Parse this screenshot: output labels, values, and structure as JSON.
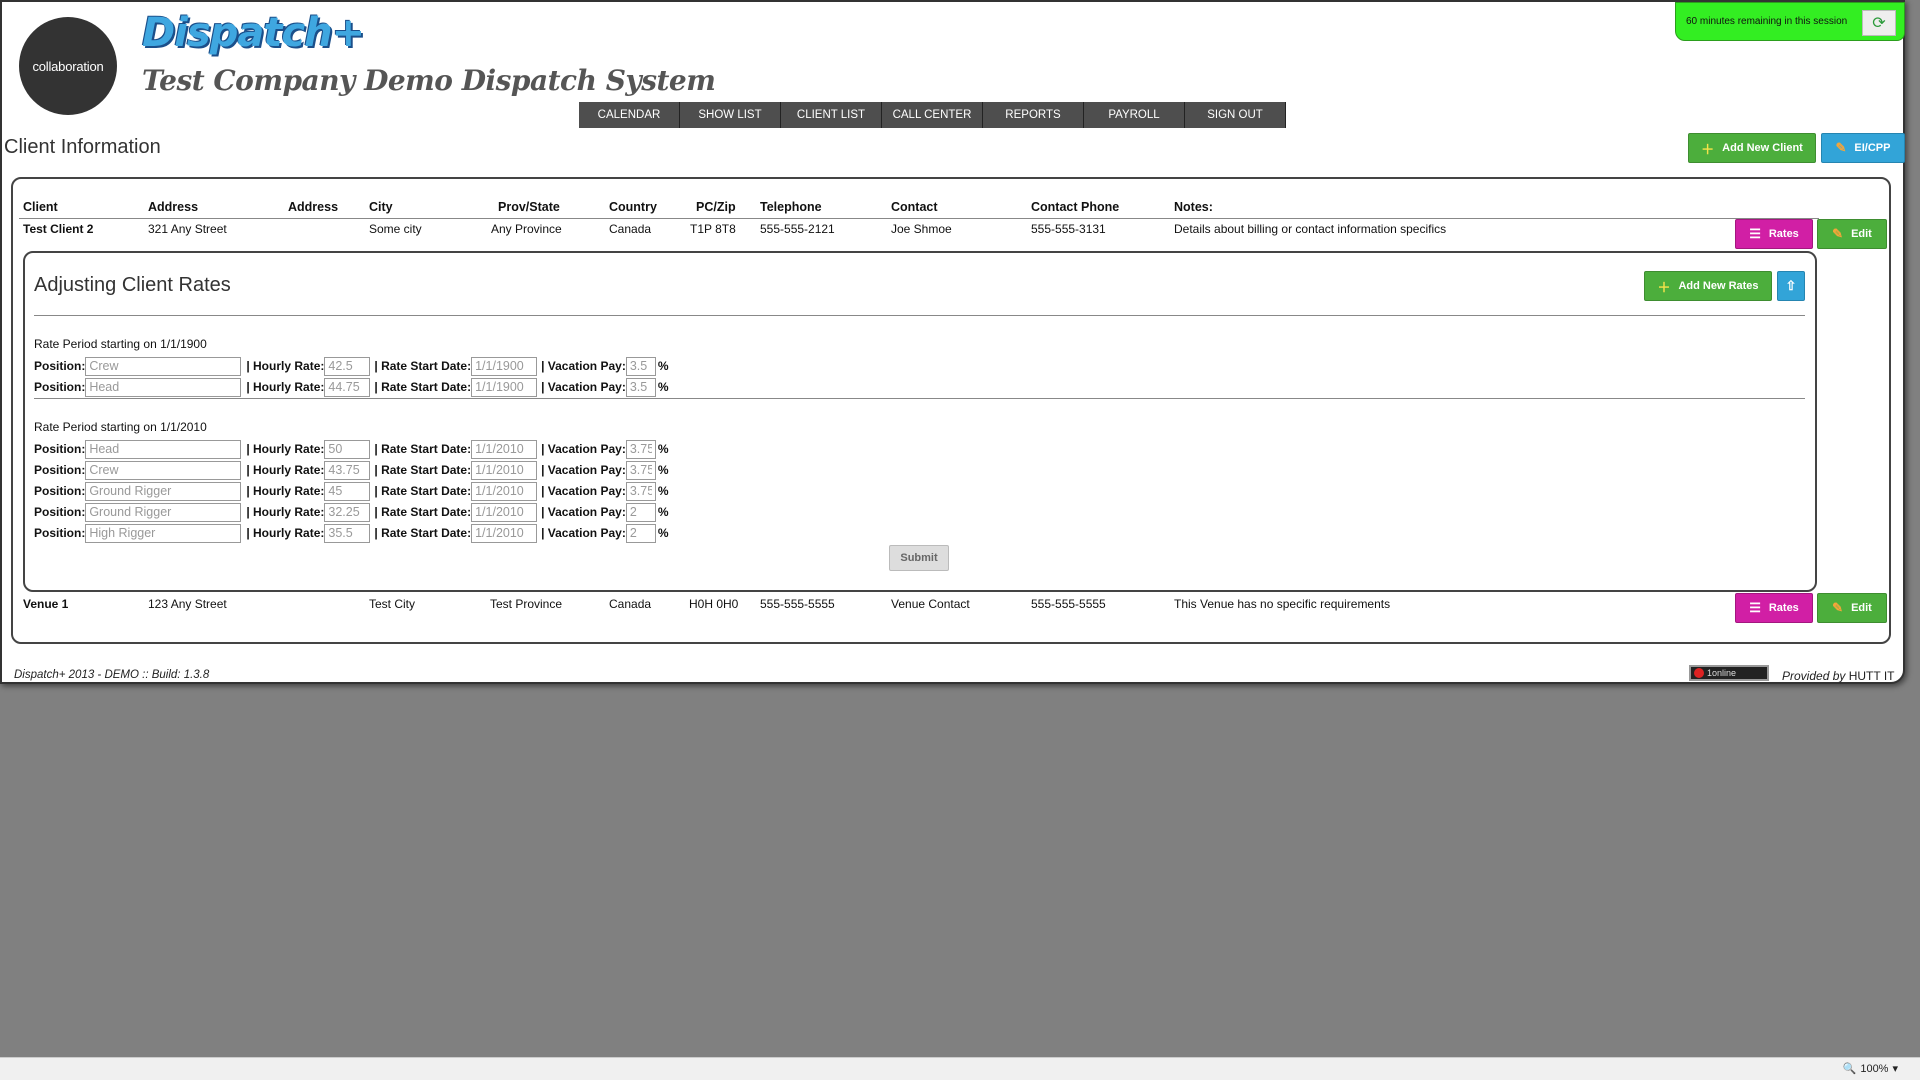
{
  "header": {
    "logo_text": "collaboration",
    "brand": "Dispatch+",
    "company": "Test Company Demo Dispatch System",
    "session_text": "60 minutes remaining in this session"
  },
  "nav": [
    "CALENDAR",
    "SHOW LIST",
    "CLIENT LIST",
    "CALL CENTER",
    "REPORTS",
    "PAYROLL",
    "SIGN OUT"
  ],
  "page_title": "Client Information",
  "buttons": {
    "add_new_client": "Add New Client",
    "ei_cpp": "EI/CPP",
    "rates": "Rates",
    "edit": "Edit",
    "add_new_rates": "Add New Rates",
    "submit": "Submit"
  },
  "table": {
    "headers": [
      "Client",
      "Address",
      "Address",
      "City",
      "Prov/State",
      "Country",
      "PC/Zip",
      "Telephone",
      "Contact",
      "Contact Phone",
      "Notes:"
    ],
    "rows": [
      [
        "Test Client 2",
        "321 Any Street",
        "",
        "Some city",
        "Any Province",
        "Canada",
        "T1P 8T8",
        "555-555-2121",
        "Joe Shmoe",
        "555-555-3131",
        "Details about billing or contact information specifics"
      ],
      [
        "Venue 1",
        "123 Any Street",
        "",
        "Test City",
        "Test Province",
        "Canada",
        "H0H 0H0",
        "555-555-5555",
        "Venue Contact",
        "555-555-5555",
        "This Venue has no specific requirements"
      ]
    ]
  },
  "rates": {
    "title": "Adjusting Client Rates",
    "labels": {
      "position": "Position:",
      "hourly": "| Hourly Rate:",
      "start": "| Rate Start Date:",
      "vacation": "| Vacation Pay:",
      "pct": "%"
    },
    "periods": [
      {
        "label": "Rate Period starting on 1/1/1900",
        "rows": [
          {
            "position": "Crew",
            "rate": "42.5",
            "date": "1/1/1900",
            "vac": "3.5"
          },
          {
            "position": "Head",
            "rate": "44.75",
            "date": "1/1/1900",
            "vac": "3.5"
          }
        ]
      },
      {
        "label": "Rate Period starting on 1/1/2010",
        "rows": [
          {
            "position": "Head",
            "rate": "50",
            "date": "1/1/2010",
            "vac": "3.75"
          },
          {
            "position": "Crew",
            "rate": "43.75",
            "date": "1/1/2010",
            "vac": "3.75"
          },
          {
            "position": "Ground Rigger",
            "rate": "45",
            "date": "1/1/2010",
            "vac": "3.75"
          },
          {
            "position": "Ground Rigger",
            "rate": "32.25",
            "date": "1/1/2010",
            "vac": "2"
          },
          {
            "position": "High Rigger",
            "rate": "35.5",
            "date": "1/1/2010",
            "vac": "2"
          }
        ]
      }
    ]
  },
  "footer": {
    "build": "Dispatch+ 2013 - DEMO :: Build: 1.3.8",
    "badge": "1online",
    "provided_prefix": "Provided by",
    "provided_name": "HUTT IT"
  },
  "statusbar": {
    "zoom": "100%"
  },
  "colors": {
    "green": "#4cae3c",
    "blue": "#32a4d8",
    "magenta": "#d11fa5",
    "session": "#33ee22"
  }
}
